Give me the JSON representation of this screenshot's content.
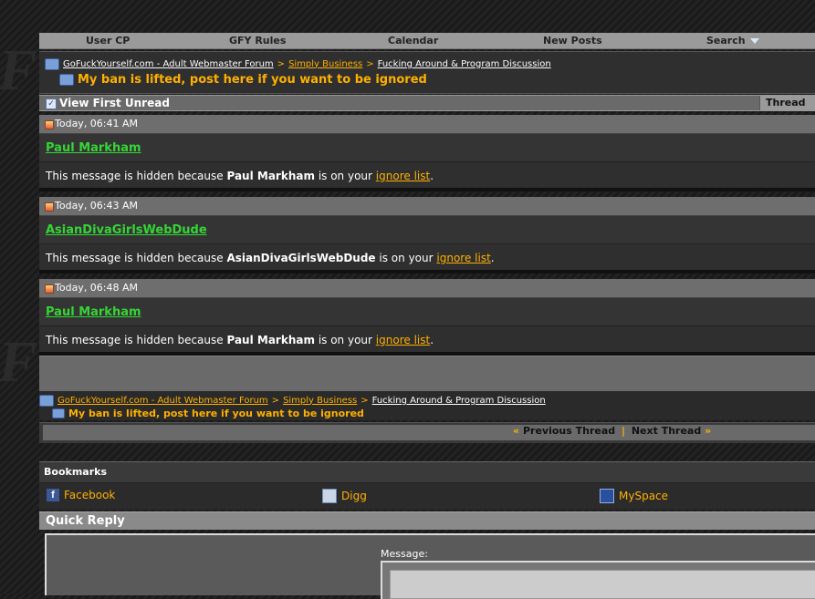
{
  "navbar": {
    "items": [
      "User CP",
      "GFY Rules",
      "Calendar",
      "New Posts",
      "Search"
    ]
  },
  "breadcrumb": {
    "home": "GoFuckYourself.com - Adult Webmaster Forum",
    "sep": ">",
    "category": "Simply Business",
    "forum": "Fucking Around & Program Discussion",
    "thread_title": "My ban is lifted, post here if you want to be ignored"
  },
  "toolbar": {
    "view_first_unread": "View First Unread",
    "thread_tools": "Thread Tools"
  },
  "posts": [
    {
      "date": "Today, 06:41 AM",
      "username": "Paul Markham",
      "msg_prefix": "This message is hidden because",
      "msg_mid": "is on your",
      "ignore_link": "ignore list",
      "msg_suffix": "."
    },
    {
      "date": "Today, 06:43 AM",
      "username": "AsianDivaGirlsWebDude",
      "msg_prefix": "This message is hidden because",
      "msg_mid": "is on your",
      "ignore_link": "ignore list",
      "msg_suffix": "."
    },
    {
      "date": "Today, 06:48 AM",
      "username": "Paul Markham",
      "msg_prefix": "This message is hidden because",
      "msg_mid": "is on your",
      "ignore_link": "ignore list",
      "msg_suffix": "."
    }
  ],
  "thread_nav": {
    "left_arrow": "«",
    "previous": "Previous Thread",
    "pipe": "|",
    "next": "Next Thread",
    "right_arrow": "»"
  },
  "bookmarks": {
    "title": "Bookmarks",
    "items": [
      {
        "label": "Facebook",
        "icon": "facebook-icon"
      },
      {
        "label": "Digg",
        "icon": "digg-icon"
      },
      {
        "label": "MySpace",
        "icon": "myspace-icon"
      }
    ]
  },
  "quick_reply": {
    "title": "Quick Reply",
    "message_label": "Message:"
  },
  "colors": {
    "accent": "#ffb000",
    "username": "#34d534",
    "background": "#1c1c1c"
  }
}
